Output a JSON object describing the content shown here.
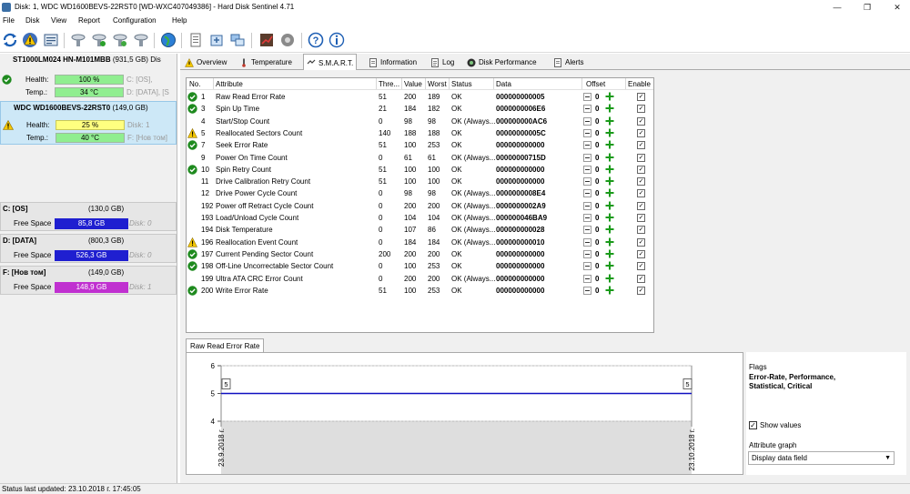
{
  "window": {
    "title": "Disk: 1, WDC WD1600BEVS-22RST0 [WD-WXC407049386] - Hard Disk Sentinel 4.71",
    "controls": [
      "—",
      "❐",
      "✕"
    ]
  },
  "menu": [
    "File",
    "Disk",
    "View",
    "Report",
    "Configuration",
    "Help"
  ],
  "toolbar": {
    "icons": [
      "refresh-icon",
      "alert-warning-icon",
      "report-icon",
      "disk-tool-1-icon",
      "disk-tool-2-icon",
      "disk-tool-3-icon",
      "disk-tool-4-icon",
      "globe-icon",
      "document-icon",
      "export-icon",
      "network-icon",
      "test-icon",
      "disk-settings-icon",
      "help-icon",
      "info-icon"
    ]
  },
  "disks": [
    {
      "name": "ST1000LM024 HN-M101MBB",
      "size": "(931,5 GB)",
      "suffix": "Dis",
      "status": "ok",
      "health_label": "Health:",
      "health": "100 %",
      "health_pct": 100,
      "temp_label": "Temp.:",
      "temp": "34 °C",
      "vol1": "C: [OS],",
      "vol2": "D: [DATA], [S",
      "selected": false
    },
    {
      "name": "WDC WD1600BEVS-22RST0",
      "size": "(149,0 GB)",
      "suffix": "",
      "status": "warning",
      "health_label": "Health:",
      "health": "25 %",
      "health_pct": 25,
      "temp_label": "Temp.:",
      "temp": "40 °C",
      "vol1": "Disk: 1",
      "vol2": "F: [Нов том]",
      "selected": true
    }
  ],
  "volumes": [
    {
      "letter": "C: [OS]",
      "size": "(130,0 GB)",
      "free_label": "Free Space",
      "free": "85,8 GB",
      "disk": "Disk: 0",
      "color": "#1f1fd0"
    },
    {
      "letter": "D: [DATA]",
      "size": "(800,3 GB)",
      "free_label": "Free Space",
      "free": "526,3 GB",
      "disk": "Disk: 0",
      "color": "#1f1fd0"
    },
    {
      "letter": "F: [Нов том]",
      "size": "(149,0 GB)",
      "free_label": "Free Space",
      "free": "148,9 GB",
      "disk": "Disk: 1",
      "color": "#c030d0"
    }
  ],
  "tabs": [
    {
      "label": "Overview",
      "icon": "warning-icon",
      "active": false
    },
    {
      "label": "Temperature",
      "icon": "thermometer-icon",
      "active": false
    },
    {
      "label": "S.M.A.R.T.",
      "icon": "smart-icon",
      "active": true
    },
    {
      "label": "Information",
      "icon": "information-icon",
      "active": false
    },
    {
      "label": "Log",
      "icon": "log-icon",
      "active": false
    },
    {
      "label": "Disk Performance",
      "icon": "performance-icon",
      "active": false
    },
    {
      "label": "Alerts",
      "icon": "alerts-icon",
      "active": false
    }
  ],
  "smart_table": {
    "headers": {
      "no": "No.",
      "attribute": "Attribute",
      "threshold": "Thre...",
      "value": "Value",
      "worst": "Worst",
      "status": "Status",
      "data": "Data",
      "offset": "Offset",
      "enable": "Enable"
    },
    "rows": [
      {
        "icon": "ok",
        "no": "1",
        "attr": "Raw Read Error Rate",
        "thr": "51",
        "val": "200",
        "worst": "189",
        "status": "OK",
        "data": "000000000005",
        "offset": "0",
        "enabled": true
      },
      {
        "icon": "ok",
        "no": "3",
        "attr": "Spin Up Time",
        "thr": "21",
        "val": "184",
        "worst": "182",
        "status": "OK",
        "data": "0000000006E6",
        "offset": "0",
        "enabled": true
      },
      {
        "icon": "",
        "no": "4",
        "attr": "Start/Stop Count",
        "thr": "0",
        "val": "98",
        "worst": "98",
        "status": "OK (Always...",
        "data": "000000000AC6",
        "offset": "0",
        "enabled": true
      },
      {
        "icon": "warn",
        "no": "5",
        "attr": "Reallocated Sectors Count",
        "thr": "140",
        "val": "188",
        "worst": "188",
        "status": "OK",
        "data": "00000000005C",
        "offset": "0",
        "enabled": true
      },
      {
        "icon": "ok",
        "no": "7",
        "attr": "Seek Error Rate",
        "thr": "51",
        "val": "100",
        "worst": "253",
        "status": "OK",
        "data": "000000000000",
        "offset": "0",
        "enabled": true
      },
      {
        "icon": "",
        "no": "9",
        "attr": "Power On Time Count",
        "thr": "0",
        "val": "61",
        "worst": "61",
        "status": "OK (Always...",
        "data": "00000000715D",
        "offset": "0",
        "enabled": true
      },
      {
        "icon": "ok",
        "no": "10",
        "attr": "Spin Retry Count",
        "thr": "51",
        "val": "100",
        "worst": "100",
        "status": "OK",
        "data": "000000000000",
        "offset": "0",
        "enabled": true
      },
      {
        "icon": "",
        "no": "11",
        "attr": "Drive Calibration Retry Count",
        "thr": "51",
        "val": "100",
        "worst": "100",
        "status": "OK",
        "data": "000000000000",
        "offset": "0",
        "enabled": true
      },
      {
        "icon": "",
        "no": "12",
        "attr": "Drive Power Cycle Count",
        "thr": "0",
        "val": "98",
        "worst": "98",
        "status": "OK (Always...",
        "data": "0000000008E4",
        "offset": "0",
        "enabled": true
      },
      {
        "icon": "",
        "no": "192",
        "attr": "Power off Retract Cycle Count",
        "thr": "0",
        "val": "200",
        "worst": "200",
        "status": "OK (Always...",
        "data": "0000000002A9",
        "offset": "0",
        "enabled": true
      },
      {
        "icon": "",
        "no": "193",
        "attr": "Load/Unload Cycle Count",
        "thr": "0",
        "val": "104",
        "worst": "104",
        "status": "OK (Always...",
        "data": "000000046BA9",
        "offset": "0",
        "enabled": true
      },
      {
        "icon": "",
        "no": "194",
        "attr": "Disk Temperature",
        "thr": "0",
        "val": "107",
        "worst": "86",
        "status": "OK (Always...",
        "data": "000000000028",
        "offset": "0",
        "enabled": true
      },
      {
        "icon": "warn",
        "no": "196",
        "attr": "Reallocation Event Count",
        "thr": "0",
        "val": "184",
        "worst": "184",
        "status": "OK (Always...",
        "data": "000000000010",
        "offset": "0",
        "enabled": true
      },
      {
        "icon": "ok",
        "no": "197",
        "attr": "Current Pending Sector Count",
        "thr": "200",
        "val": "200",
        "worst": "200",
        "status": "OK",
        "data": "000000000000",
        "offset": "0",
        "enabled": true
      },
      {
        "icon": "ok",
        "no": "198",
        "attr": "Off-Line Uncorrectable Sector Count",
        "thr": "0",
        "val": "100",
        "worst": "253",
        "status": "OK",
        "data": "000000000000",
        "offset": "0",
        "enabled": true
      },
      {
        "icon": "",
        "no": "199",
        "attr": "Ultra ATA CRC Error Count",
        "thr": "0",
        "val": "200",
        "worst": "200",
        "status": "OK (Always...",
        "data": "000000000000",
        "offset": "0",
        "enabled": true
      },
      {
        "icon": "ok",
        "no": "200",
        "attr": "Write Error Rate",
        "thr": "51",
        "val": "100",
        "worst": "253",
        "status": "OK",
        "data": "000000000000",
        "offset": "0",
        "enabled": true
      }
    ]
  },
  "graph": {
    "tab_label": "Raw Read Error Rate",
    "y_ticks": [
      "6",
      "5",
      "4"
    ],
    "x_ticks": [
      "23.9.2018 г.",
      "23.10.2018 г."
    ],
    "point_labels": [
      "5",
      "5"
    ]
  },
  "chart_data": {
    "type": "line",
    "title": "Raw Read Error Rate",
    "x": [
      "23.9.2018 г.",
      "23.10.2018 г."
    ],
    "series": [
      {
        "values": [
          5,
          5
        ]
      }
    ],
    "ylim": [
      4,
      6
    ],
    "grid": true
  },
  "flags_panel": {
    "flags_label": "Flags",
    "flags_value": "Error-Rate, Performance, Statistical, Critical",
    "show_values_label": "Show values",
    "show_values_checked": true,
    "attribute_graph_label": "Attribute graph",
    "attribute_graph_value": "Display data field"
  },
  "status_bar": "Status last updated: 23.10.2018 г. 17:45:05",
  "colors": {
    "health_ok": "#90ee90",
    "health_warn": "#ffff80",
    "selected_disk_bg": "#cde8f7",
    "ok_icon": "#1e8a1e",
    "warn_icon": "#f2c200",
    "graph_line": "#1010c0"
  }
}
